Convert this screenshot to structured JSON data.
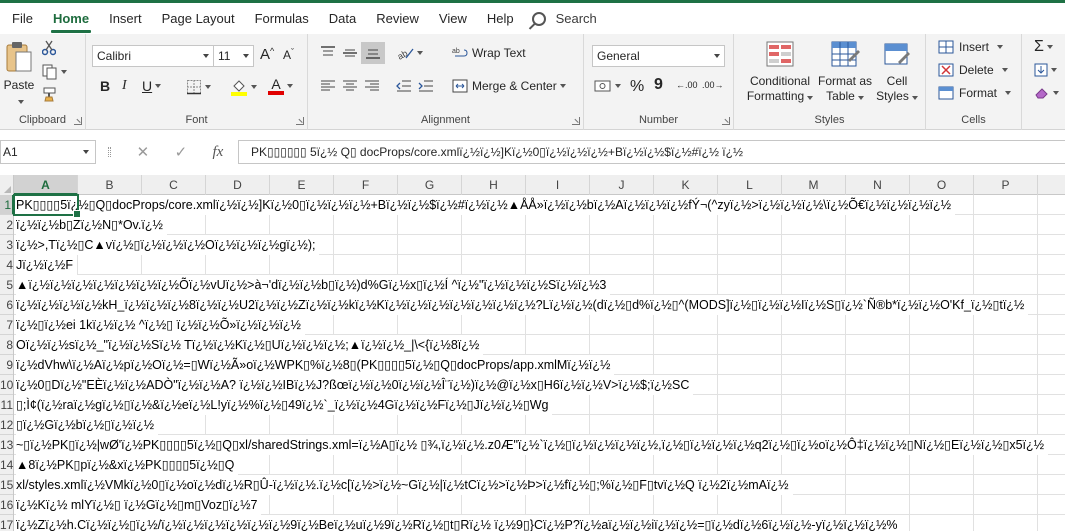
{
  "menu": {
    "items": [
      "File",
      "Home",
      "Insert",
      "Page Layout",
      "Formulas",
      "Data",
      "Review",
      "View",
      "Help"
    ],
    "active": "Home",
    "search_label": "Search"
  },
  "ribbon": {
    "clipboard": {
      "paste": "Paste",
      "label": "Clipboard"
    },
    "font": {
      "name": "Calibri",
      "size": "11",
      "bold": "B",
      "italic": "I",
      "underline": "U",
      "grow": "A",
      "shrink": "A",
      "font_color_letter": "A",
      "label": "Font"
    },
    "alignment": {
      "wrap_text": "Wrap Text",
      "merge_center": "Merge & Center",
      "label": "Alignment"
    },
    "number": {
      "format": "General",
      "percent": "%",
      "comma": "9",
      "inc_decimal": "←.00",
      "dec_decimal": ".00→",
      "label": "Number"
    },
    "styles": {
      "conditional": [
        "Conditional",
        "Formatting"
      ],
      "format_table": [
        "Format as",
        "Table"
      ],
      "cell_styles": [
        "Cell",
        "Styles"
      ],
      "label": "Styles"
    },
    "cells": {
      "insert": "Insert",
      "delete": "Delete",
      "format": "Format",
      "label": "Cells"
    },
    "editing": {
      "sum": "Σ"
    }
  },
  "formula_bar": {
    "name_box": "A1",
    "cancel": "✕",
    "enter": "✓",
    "fx": "fx",
    "content": "PK▯▯▯▯▯▯ 5ï¿½ Q▯ docProps/core.xmlï¿½ï¿½]Kï¿½0▯ï¿½ï¿½ï¿½+Bï¿½ï¿½$ï¿½#ï¿½  ï¿½"
  },
  "grid": {
    "columns": [
      "A",
      "B",
      "C",
      "D",
      "E",
      "F",
      "G",
      "H",
      "I",
      "J",
      "K",
      "L",
      "M",
      "N",
      "O",
      "P"
    ],
    "selected_column": "A",
    "selected_row": "1",
    "rows": [
      {
        "num": "1",
        "text": "PK▯▯▯▯5ï¿½▯Q▯docProps/core.xmlï¿½ï¿½]Kï¿½0▯ï¿½ï¿½ï¿½+Bï¿½ï¿½$ï¿½#ï¿½ï¿½▲ÅÅ»ï¿½ï¿½bï¿½Aï¿½ï¿½ï¿½fÝ¬(^zyï¿½>ï¿½ï¿½ï¿½\\ï¿½Õ€ï¿½ï¿½ï¿½ï¿½"
      },
      {
        "num": "2",
        "text": "ï¿½ï¿½b▯Zï¿½N▯*Ov.ï¿½"
      },
      {
        "num": "3",
        "text": "ï¿½>,Tï¿½▯C▲vï¿½▯ï¿½ï¿½ï¿½Oï¿½ï¿½ï¿½gï¿½);"
      },
      {
        "num": "4",
        "text": "Jï¿½ï¿½F"
      },
      {
        "num": "5",
        "text": "▲ï¿½ï¿½ï¿½ï¿½ï¿½ï¿½ï¿½Õï¿½vUï¿½>à¬'dï¿½ï¿½b▯ï¿½)d%Gï¿½x▯ï¿½Í ^ï¿½\"ï¿½ï¿½ï¿½Sï¿½ï¿½3"
      },
      {
        "num": "6",
        "text": "ï¿½ï¿½ï¿½ï¿½kH_ï¿½ï¿½ï¿½8ï¿½ï¿½U2ï¿½ï¿½Zï¿½ï¿½kï¿½Kï¿½ï¿½ï¿½ï¿½ï¿½ï¿½ï¿½?Lï¿½ï¿½(dï¿½▯d%ï¿½▯^(MODS]ï¿½▯ï¿½ï¿½Iï¿½S▯ï¿½`Ñ®b*ï¿½ï¿½O'Kf_ï¿½▯tï¿½"
      },
      {
        "num": "7",
        "text": "ï¿½▯ï¿½ei 1kï¿½ï¿½ ^ï¿½▯  ï¿½ï¿½Õ»ï¿½ï¿½ï¿½"
      },
      {
        "num": "8",
        "text": "Oï¿½ï¿½sï¿½_\"ï¿½ï¿½Sï¿½ Tï¿½ï¿½Kï¿½▯Uï¿½ï¿½ï¿½;▲ï¿½ï¿½_|\\<{ï¿½8ï¿½"
      },
      {
        "num": "9",
        "text": "ï¿½dVhw\\ï¿½Aï¿½pï¿½Oï¿½=▯Wï¿½Ã»oï¿½WPK▯%ï¿½8▯(PK▯▯▯▯5ï¿½▯Q▯docProps/app.xmlMï¿½ï¿½"
      },
      {
        "num": "10",
        "text": "ï¿½0▯Dï¿½\"EÈï¿½ï¿½ADÒ\"ï¿½ï¿½A? ï¿½ï¿½IBï¿½J?ßœï¿½ï¿½0ï¿½ï¿½Î¨ï¿½)ï¿½@ï¿½x▯H6ï¿½ï¿½V>ï¿½$;ï¿½SC"
      },
      {
        "num": "11",
        "text": "▯;Ì¢(ï¿½raï¿½gï¿½▯ï¿½&ï¿½eï¿½L!yï¿½%ï¿½▯49ï¿½`_ï¿½ï¿½4Gï¿½ï¿½Fï¿½▯Jï¿½ï¿½▯Wg"
      },
      {
        "num": "12",
        "text": "▯ï¿½Gï¿½bï¿½▯ï¿½ï¿½"
      },
      {
        "num": "13",
        "text": "~▯ï¿½PK▯ï¿½|wØ'ï¿½PK▯▯▯▯5ï¿½▯Q▯xl/sharedStrings.xml=ï¿½A▯ï¿½ ▯¾,ï¿½ï¿½.z0Æ\"ï¿½`ï¿½▯ï¿½ï¿½ï¿½ï¿½,ï¿½▯ï¿½ï¿½ï¿½q2ï¿½▯ï¿½oï¿½Ô‡ï¿½ï¿½▯Nï¿½▯Eï¿½ï¿½▯x5ï¿½"
      },
      {
        "num": "14",
        "text": "▲8ï¿½PK▯pï¿½&xï¿½PK▯▯▯▯5ï¿½▯Q"
      },
      {
        "num": "15",
        "text": "xl/styles.xmlï¿½VMkï¿½0▯ï¿½oï¿½dï¿½R▯Û-ï¿½ï¿½.ï¿½c[ï¿½>ï¿½~Gï¿½|ï¿½tCï¿½>ï¿½Þ>ï¿½fï¿½▯;%ï¿½▯F▯tvï¿½Q  ï¿½2ï¿½mAï¿½"
      },
      {
        "num": "16",
        "text": "ï¿½Kï¿½ mlYï¿½▯ ï¿½Gï¿½▯m▯Voz▯ï¿½7"
      },
      {
        "num": "17",
        "text": "ï¿½Zï¿½h.Cï¿½ï¿½▯ï¿½/ï¿½ï¿½ï¿½ï¿½ï¿½ï¿½9ï¿½Beï¿½uï¿½9ï¿½Rï¿½▯t▯Rï¿½ ï¿½9▯}Cï¿½P?ï¿½aï¿½ï¿½iï¿½ï¿½=▯ï¿½dï¿½6ï¿½ï¿½-yï¿½ï¿½ï¿½%"
      }
    ]
  },
  "colors": {
    "accent": "#1e7145",
    "ribbon_bg": "#f3f3f3",
    "header_bg": "#efefef"
  }
}
